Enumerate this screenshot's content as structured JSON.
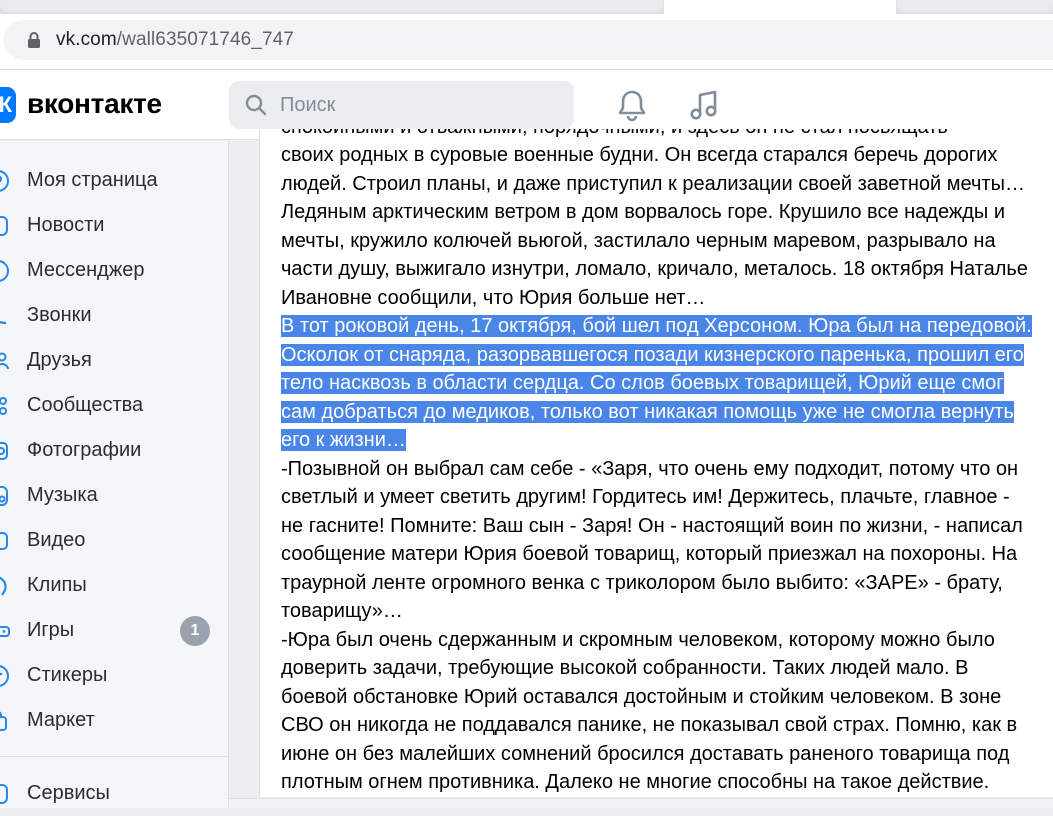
{
  "browser": {
    "url_host": "vk.com",
    "url_path": "/wall635071746_747"
  },
  "header": {
    "logo_letter": "К",
    "wordmark": "вконтакте",
    "search_placeholder": "Поиск",
    "icons": [
      "bell-icon",
      "music-note-icon"
    ]
  },
  "sidebar": {
    "items": [
      {
        "label": "Моя страница",
        "icon": "user-circle-icon"
      },
      {
        "label": "Новости",
        "icon": "newspaper-icon"
      },
      {
        "label": "Мессенджер",
        "icon": "message-bubble-icon"
      },
      {
        "label": "Звонки",
        "icon": "phone-icon"
      },
      {
        "label": "Друзья",
        "icon": "friends-icon"
      },
      {
        "label": "Сообщества",
        "icon": "communities-icon"
      },
      {
        "label": "Фотографии",
        "icon": "photo-icon"
      },
      {
        "label": "Музыка",
        "icon": "music-icon"
      },
      {
        "label": "Видео",
        "icon": "video-icon"
      },
      {
        "label": "Клипы",
        "icon": "clips-icon"
      },
      {
        "label": "Игры",
        "icon": "games-icon",
        "badge": "1"
      },
      {
        "label": "Стикеры",
        "icon": "stickers-icon"
      },
      {
        "label": "Маркет",
        "icon": "market-icon"
      },
      {
        "label": "Сервисы",
        "icon": "services-icon"
      }
    ]
  },
  "post": {
    "lines": [
      "своих родных в суровые военные будни. Он всегда старался беречь дорогих",
      "людей. Строил планы, и даже приступил к реализации своей заветной мечты…",
      "Ледяным арктическим ветром в дом ворвалось горе. Крушило все надежды и",
      "мечты, кружило колючей вьюгой, застилало черным маревом, разрывало на",
      "части душу, выжигало изнутри, ломало, кричало, металось. 18 октября Наталье",
      "Ивановне сообщили, что Юрия больше нет…"
    ],
    "selected_lines": [
      "В тот роковой день, 17 октября, бой шел под Херсоном. Юра был на передовой.",
      "Осколок от снаряда, разорвавшегося позади кизнерского паренька, прошил его",
      "тело насквозь в области сердца. Со слов боевых товарищей, Юрий еще смог",
      "сам добраться до медиков, только вот никакая помощь уже не смогла вернуть",
      "его к жизни…"
    ],
    "after_lines": [
      "-Позывной он выбрал сам себе - «Заря, что очень ему подходит, потому что он",
      "светлый и умеет светить другим! Гордитесь им! Держитесь, плачьте, главное -",
      "не гасните! Помните: Ваш сын - Заря! Он - настоящий воин по жизни, - написал",
      "сообщение матери Юрия боевой товарищ, который приезжал на похороны. На",
      "траурной ленте огромного венка с триколором было выбито: «ЗАРЕ» - брату,",
      "товарищу»…",
      "-Юра был очень сдержанным и скромным человеком, которому можно было",
      "доверить задачи, требующие высокой собранности. Таких людей мало. В",
      "боевой обстановке Юрий оставался достойным и стойким человеком. В зоне",
      "СВО он никогда не поддавался панике, не показывал свой страх. Помню, как в",
      "июне он без малейших сомнений бросился доставать раненого товарища под",
      "плотным огнем противника. Далеко не многие способны на такое действие."
    ]
  }
}
